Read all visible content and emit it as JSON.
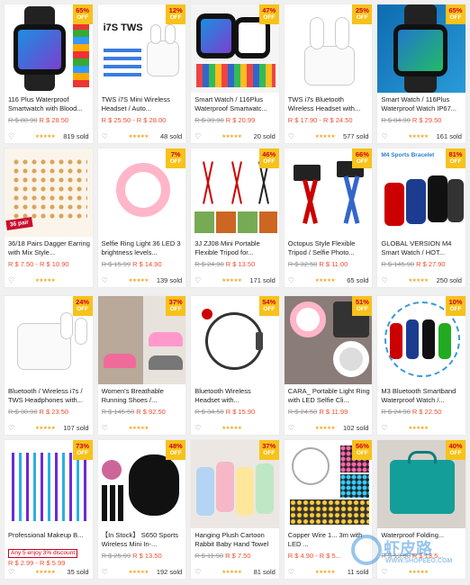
{
  "colors": {
    "accent": "#ee4d2d",
    "badge": "#f7c21a",
    "stars": "#f5a623"
  },
  "off_label": "OFF",
  "rows": [
    [
      {
        "title": "116 Plus Waterproof Smartwatch with Blood...",
        "badge": "65%",
        "old": "R $ 80.90",
        "now": "R $ 28.50",
        "sold": "819 sold",
        "visual": "watch"
      },
      {
        "title": "TWS i7S Mini Wireless Headset / Auto...",
        "badge": "12%",
        "old": "",
        "now": "R $ 25.50 - R $ 28.00",
        "sold": "48 sold",
        "visual": "earbuds-box",
        "box_title": "i7S TWS"
      },
      {
        "title": "Smart Watch / 116Plus Waterproof Smartwatc...",
        "badge": "47%",
        "old": "R $ 39.90",
        "now": "R $ 20.99",
        "sold": "20 sold",
        "visual": "watches"
      },
      {
        "title": "TWS i7s Bluetooth Wireless Headset with...",
        "badge": "25%",
        "old": "",
        "now": "R $ 17.90 - R $ 24.50",
        "sold": "577 sold",
        "visual": "earbuds"
      },
      {
        "title": "Smart Watch / 116Plus Waterproof Watch IP67...",
        "badge": "65%",
        "old": "R $ 84.90",
        "now": "R $ 29.50",
        "sold": "161 sold",
        "visual": "watch-blue"
      }
    ],
    [
      {
        "title": "36/18 Pairs Dagger Earring with Mix Style...",
        "badge": "",
        "old": "",
        "now": "R $ 7.50 - R $ 10.90",
        "sold": "",
        "visual": "earrings",
        "tag": "36 pair"
      },
      {
        "title": "Selfie Ring Light 36 LED 3 brightness levels...",
        "badge": "7%",
        "old": "R $ 15.99",
        "now": "R $ 14.90",
        "sold": "139 sold",
        "visual": "ring"
      },
      {
        "title": "3J ZJ08 Mini Portable Flexible Tripod for...",
        "badge": "46%",
        "old": "R $ 24.90",
        "now": "R $ 13.50",
        "sold": "171 sold",
        "visual": "tripods"
      },
      {
        "title": "Octopus Style Flexible Tripod / Selfie Photo...",
        "badge": "66%",
        "old": "R $ 32.50",
        "now": "R $ 11.00",
        "sold": "65 sold",
        "visual": "octopus"
      },
      {
        "title": "GLOBAL VERSION M4 Smart Watch / HOT...",
        "badge": "81%",
        "old": "R $ 145.90",
        "now": "R $ 27.90",
        "sold": "250 sold",
        "visual": "bands",
        "box_title": "M4 Sports Bracelet"
      }
    ],
    [
      {
        "title": "Bluetooth / Wireless i7s / TWS Headphones with...",
        "badge": "24%",
        "old": "R $ 30.90",
        "now": "R $ 23.50",
        "sold": "107 sold",
        "visual": "earbuds2"
      },
      {
        "title": "Women's Breathable Running Shoes /...",
        "badge": "37%",
        "old": "R $ 145.50",
        "now": "R $ 92.50",
        "sold": "",
        "visual": "shoes"
      },
      {
        "title": "Bluetooth Wireless Headset with...",
        "badge": "54%",
        "old": "R $ 34.50",
        "now": "R $ 15.90",
        "sold": "",
        "visual": "headset"
      },
      {
        "title": "CARA_ Portable Light Ring with LED Selfie Cli...",
        "badge": "51%",
        "old": "R $ 24.50",
        "now": "R $ 11.99",
        "sold": "102 sold",
        "visual": "selfie"
      },
      {
        "title": "M3 Bluetooth Smartband Waterproof Watch /...",
        "badge": "10%",
        "old": "R $ 24.90",
        "now": "R $ 22.50",
        "sold": "",
        "visual": "m3"
      }
    ],
    [
      {
        "title": "Professional Makeup B...",
        "badge": "73%",
        "old": "",
        "now": "R $ 2.99 - R $ 5.99",
        "sold": "35 sold",
        "visual": "brushes",
        "promo": "Any 5 enjoy 3% discount"
      },
      {
        "title": "【In Stock】 S650 Sports Wireless Mini In-...",
        "badge": "48%",
        "old": "R $ 25.99",
        "now": "R $ 13.50",
        "sold": "192 sold",
        "visual": "minibud"
      },
      {
        "title": "Hanging Plush Cartoon Rabbit Baby Hand Towel",
        "badge": "37%",
        "old": "R $ 11.90",
        "now": "R $ 7.50",
        "sold": "81 sold",
        "visual": "towels"
      },
      {
        "title": "Copper Wire 1... 3m with LED ...",
        "badge": "56%",
        "old": "",
        "now": "R $ 4.90 - R $ 5...",
        "sold": "11 sold",
        "visual": "lights"
      },
      {
        "title": "Waterproof Folding...",
        "badge": "40%",
        "old": "R $ 19.90",
        "now": "R $ 13.5...",
        "sold": "",
        "visual": "bag"
      }
    ]
  ],
  "watermark": {
    "text": "虾皮路",
    "url": "WWW.SHOPEEO.COM"
  }
}
